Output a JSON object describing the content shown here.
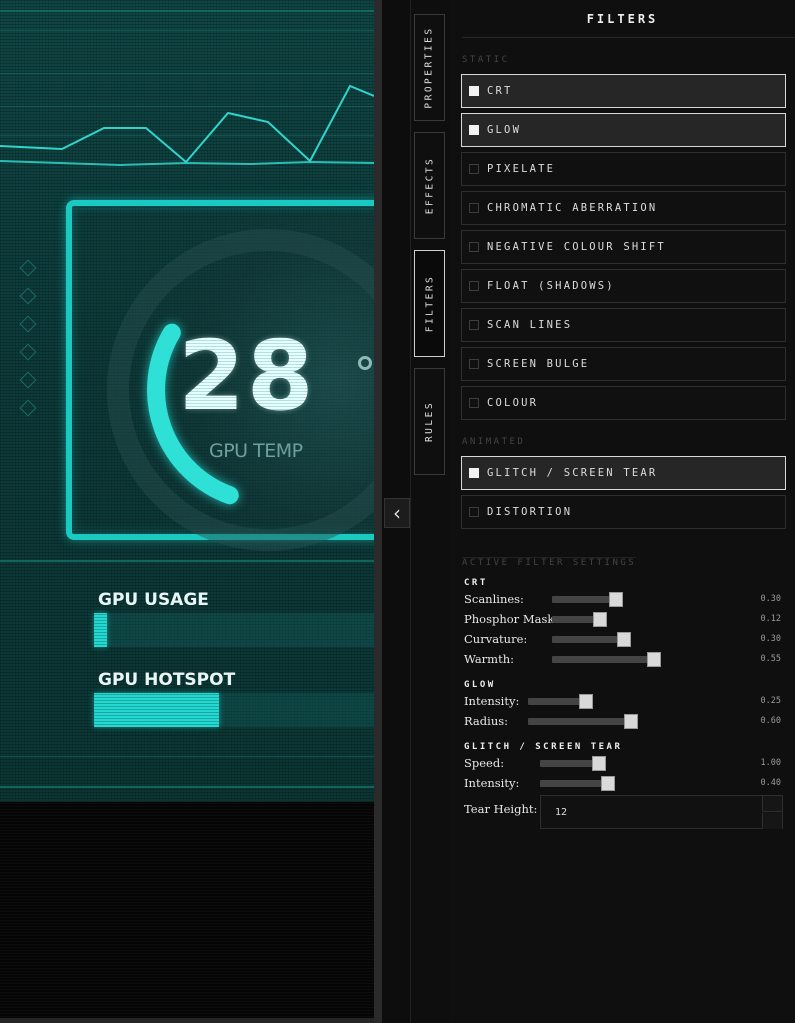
{
  "preview": {
    "temp_value": "28",
    "temp_label": "GPU TEMP",
    "gpu_usage_label": "GPU USAGE",
    "gpu_usage_level": 0.045,
    "gpu_hotspot_label": "GPU HOTSPOT",
    "gpu_hotspot_level": 0.43,
    "gauge_level": 0.28
  },
  "collapse_icon": "chevron-left-icon",
  "side_tabs": [
    {
      "label": "PROPERTIES",
      "active": false
    },
    {
      "label": "EFFECTS",
      "active": false
    },
    {
      "label": "FILTERS",
      "active": true
    },
    {
      "label": "RULES",
      "active": false
    }
  ],
  "panel": {
    "title": "FILTERS",
    "static_label": "STATIC",
    "animated_label": "ANIMATED",
    "active_settings_label": "ACTIVE FILTER SETTINGS"
  },
  "static_filters": [
    {
      "name": "CRT",
      "checked": true
    },
    {
      "name": "GLOW",
      "checked": true
    },
    {
      "name": "PIXELATE",
      "checked": false
    },
    {
      "name": "CHROMATIC ABERRATION",
      "checked": false
    },
    {
      "name": "NEGATIVE COLOUR SHIFT",
      "checked": false
    },
    {
      "name": "FLOAT (SHADOWS)",
      "checked": false
    },
    {
      "name": "SCAN LINES",
      "checked": false
    },
    {
      "name": "SCREEN BULGE",
      "checked": false
    },
    {
      "name": "COLOUR",
      "checked": false
    }
  ],
  "animated_filters": [
    {
      "name": "GLITCH / SCREEN TEAR",
      "checked": true
    },
    {
      "name": "DISTORTION",
      "checked": false
    }
  ],
  "settings": {
    "crt": {
      "title": "CRT",
      "scanlines": {
        "label": "Scanlines:",
        "value": "0.30"
      },
      "phosphor": {
        "label": "Phosphor Mask:",
        "value": "0.12"
      },
      "curvature": {
        "label": "Curvature:",
        "value": "0.30"
      },
      "warmth": {
        "label": "Warmth:",
        "value": "0.55"
      }
    },
    "glow": {
      "title": "GLOW",
      "intensity": {
        "label": "Intensity:",
        "value": "0.25"
      },
      "radius": {
        "label": "Radius:",
        "value": "0.60"
      }
    },
    "glitch": {
      "title": "GLITCH / SCREEN TEAR",
      "speed": {
        "label": "Speed:",
        "value": "1.00"
      },
      "intensity": {
        "label": "Intensity:",
        "value": "0.40"
      },
      "tear_height": {
        "label": "Tear Height:",
        "value": "12"
      }
    }
  },
  "colors": {
    "accent_cyan": "#22d8d0",
    "panel_bg": "#0f0f0f",
    "active_border": "#d8d8d8"
  }
}
